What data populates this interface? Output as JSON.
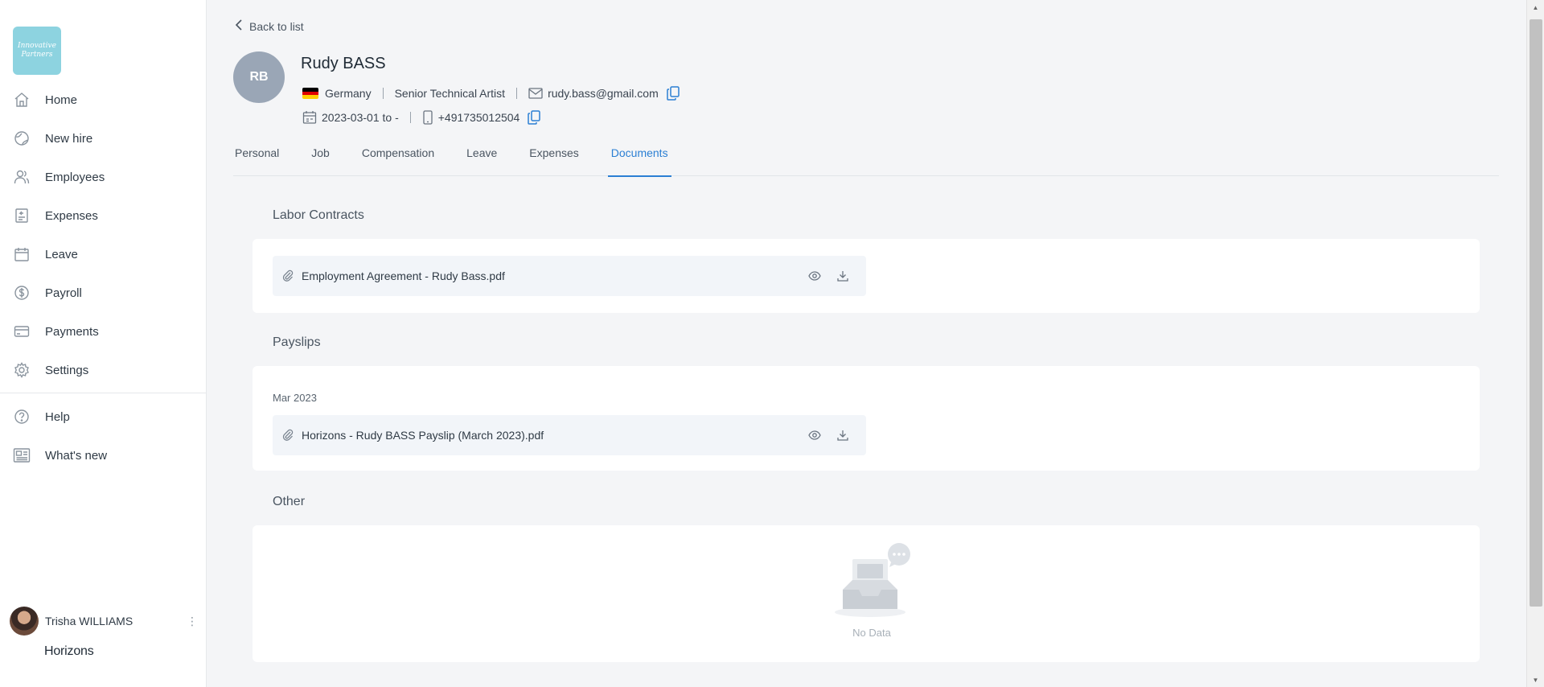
{
  "sidebar": {
    "logo_line1": "Innovative",
    "logo_line2": "Partners",
    "items": [
      {
        "label": "Home",
        "icon": "home-icon"
      },
      {
        "label": "New hire",
        "icon": "globe-icon"
      },
      {
        "label": "Employees",
        "icon": "users-icon"
      },
      {
        "label": "Expenses",
        "icon": "receipt-icon"
      },
      {
        "label": "Leave",
        "icon": "calendar-icon"
      },
      {
        "label": "Payroll",
        "icon": "dollar-icon"
      },
      {
        "label": "Payments",
        "icon": "card-icon"
      },
      {
        "label": "Settings",
        "icon": "gear-icon"
      }
    ],
    "secondary": [
      {
        "label": "Help",
        "icon": "help-icon"
      },
      {
        "label": "What's new",
        "icon": "news-icon"
      }
    ],
    "user_name": "Trisha WILLIAMS",
    "brand": "Horizons"
  },
  "header": {
    "back_label": "Back to list",
    "initials": "RB",
    "name": "Rudy BASS",
    "country": "Germany",
    "title": "Senior Technical Artist",
    "email": "rudy.bass@gmail.com",
    "dates": "2023-03-01 to -",
    "phone": "+491735012504"
  },
  "tabs": [
    {
      "label": "Personal",
      "active": false
    },
    {
      "label": "Job",
      "active": false
    },
    {
      "label": "Compensation",
      "active": false
    },
    {
      "label": "Leave",
      "active": false
    },
    {
      "label": "Expenses",
      "active": false
    },
    {
      "label": "Documents",
      "active": true
    }
  ],
  "sections": {
    "labor": {
      "title": "Labor Contracts",
      "file": "Employment Agreement - Rudy Bass.pdf"
    },
    "payslips": {
      "title": "Payslips",
      "month": "Mar 2023",
      "file": "Horizons - Rudy BASS Payslip (March 2023).pdf"
    },
    "other": {
      "title": "Other",
      "empty_text": "No Data"
    }
  },
  "colors": {
    "accent": "#2b7fd3",
    "logo_bg": "#8dd3e0",
    "avatar_bg": "#9aa6b6"
  }
}
